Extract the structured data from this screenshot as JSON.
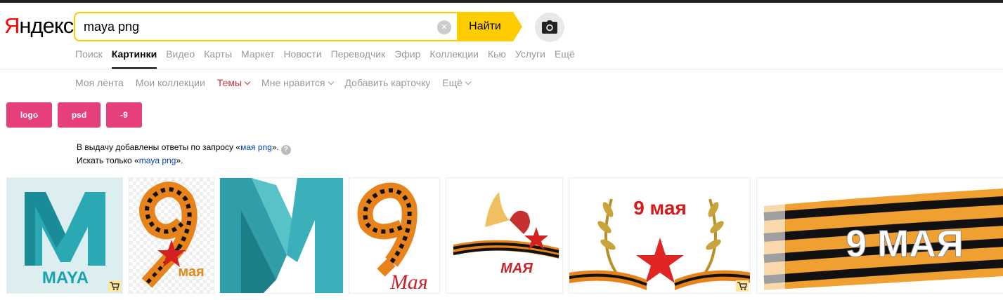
{
  "logo": {
    "ya": "Я",
    "rest": "ндекс"
  },
  "search": {
    "value": "maya png",
    "find_label": "Найти"
  },
  "services": [
    "Поиск",
    "Картинки",
    "Видео",
    "Карты",
    "Маркет",
    "Новости",
    "Переводчик",
    "Эфир",
    "Коллекции",
    "Кью",
    "Услуги",
    "Ещё"
  ],
  "active_service": "Картинки",
  "subnav": {
    "feed": "Моя лента",
    "collections": "Мои коллекции",
    "themes": "Темы",
    "likes": "Мне нравится",
    "add_card": "Добавить карточку",
    "more": "Ещё"
  },
  "chips": [
    "logo",
    "psd",
    "-9"
  ],
  "note": {
    "line1_prefix": "В выдачу добавлены ответы по запросу «",
    "line1_query": "мая png",
    "line1_suffix": "».",
    "line2_prefix": "Искать только «",
    "line2_query": "maya png",
    "line2_suffix": "»."
  },
  "images": [
    {
      "name": "maya-logo",
      "text": "MAYA",
      "shop": true
    },
    {
      "name": "nine-ribbon-star",
      "text": "мая",
      "shop": false
    },
    {
      "name": "maya-m-large",
      "text": "",
      "shop": false
    },
    {
      "name": "nine-ribbon-script",
      "text": "Мая",
      "shop": false
    },
    {
      "name": "victory-day-emblem",
      "text": "МАЯ",
      "shop": false
    },
    {
      "name": "laurel-wreath-nine",
      "text": "9 мая",
      "shop": true
    },
    {
      "name": "ribbon-banner",
      "text": "9 МАЯ",
      "shop": false
    }
  ],
  "colors": {
    "accent_yellow": "#ffcc00",
    "chip_pink": "#e5407c",
    "link_blue": "#0044bb",
    "theme_red": "#c83437"
  }
}
